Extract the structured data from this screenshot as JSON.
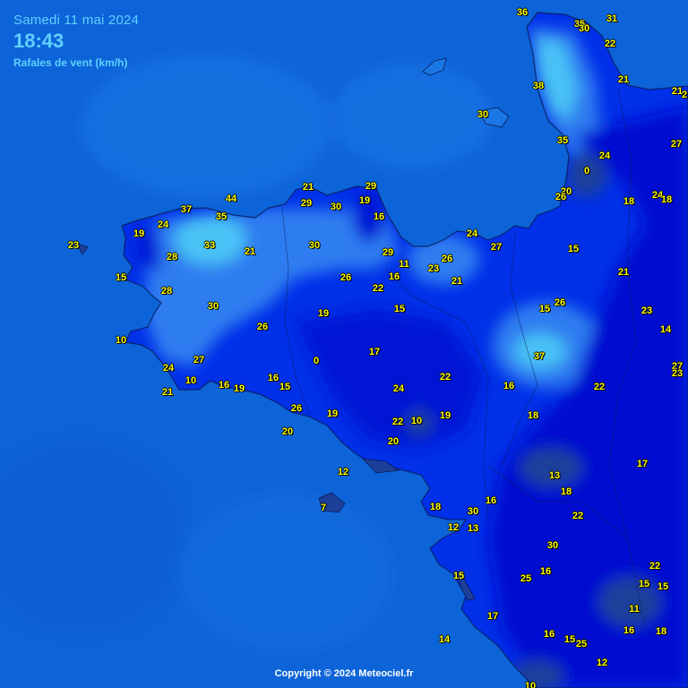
{
  "header": {
    "date": "Samedi 11 mai 2024",
    "time": "18:43",
    "title": "Rafales de vent (km/h)"
  },
  "footer": {
    "copyright": "Copyright © 2024 Meteociel.fr"
  },
  "colors": {
    "sea": "#0d64d8",
    "land_low": "#0010d0",
    "land_mid": "#0030e8",
    "land_high": "#2f7df0",
    "land_peak": "#48c2f5",
    "calm": "#1c3f9a",
    "label": "#ffff00"
  },
  "stations": [
    {
      "value": "36"
    },
    {
      "value": "35"
    },
    {
      "value": "30"
    },
    {
      "value": "31"
    },
    {
      "value": "22"
    },
    {
      "value": "38"
    },
    {
      "value": "21"
    },
    {
      "value": "21"
    },
    {
      "value": "2"
    },
    {
      "value": "30"
    },
    {
      "value": "27"
    },
    {
      "value": "35"
    },
    {
      "value": "24"
    },
    {
      "value": "0"
    },
    {
      "value": "20"
    },
    {
      "value": "26"
    },
    {
      "value": "18"
    },
    {
      "value": "24"
    },
    {
      "value": "18"
    },
    {
      "value": "44"
    },
    {
      "value": "21"
    },
    {
      "value": "29"
    },
    {
      "value": "29"
    },
    {
      "value": "30"
    },
    {
      "value": "19"
    },
    {
      "value": "16"
    },
    {
      "value": "37"
    },
    {
      "value": "35"
    },
    {
      "value": "24"
    },
    {
      "value": "19"
    },
    {
      "value": "23"
    },
    {
      "value": "33"
    },
    {
      "value": "30"
    },
    {
      "value": "21"
    },
    {
      "value": "28"
    },
    {
      "value": "24"
    },
    {
      "value": "27"
    },
    {
      "value": "29"
    },
    {
      "value": "26"
    },
    {
      "value": "11"
    },
    {
      "value": "23"
    },
    {
      "value": "15"
    },
    {
      "value": "16"
    },
    {
      "value": "26"
    },
    {
      "value": "22"
    },
    {
      "value": "21"
    },
    {
      "value": "28"
    },
    {
      "value": "15"
    },
    {
      "value": "21"
    },
    {
      "value": "30"
    },
    {
      "value": "19"
    },
    {
      "value": "15"
    },
    {
      "value": "26"
    },
    {
      "value": "15"
    },
    {
      "value": "23"
    },
    {
      "value": "10"
    },
    {
      "value": "26"
    },
    {
      "value": "14"
    },
    {
      "value": "17"
    },
    {
      "value": "27"
    },
    {
      "value": "0"
    },
    {
      "value": "37"
    },
    {
      "value": "23"
    },
    {
      "value": "24"
    },
    {
      "value": "27"
    },
    {
      "value": "22"
    },
    {
      "value": "10"
    },
    {
      "value": "16"
    },
    {
      "value": "16"
    },
    {
      "value": "19"
    },
    {
      "value": "15"
    },
    {
      "value": "16"
    },
    {
      "value": "24"
    },
    {
      "value": "22"
    },
    {
      "value": "21"
    },
    {
      "value": "26"
    },
    {
      "value": "19"
    },
    {
      "value": "10"
    },
    {
      "value": "19"
    },
    {
      "value": "18"
    },
    {
      "value": "22"
    },
    {
      "value": "20"
    },
    {
      "value": "20"
    },
    {
      "value": "12"
    },
    {
      "value": "13"
    },
    {
      "value": "17"
    },
    {
      "value": "18"
    },
    {
      "value": "16"
    },
    {
      "value": "7"
    },
    {
      "value": "18"
    },
    {
      "value": "30"
    },
    {
      "value": "22"
    },
    {
      "value": "12"
    },
    {
      "value": "13"
    },
    {
      "value": "30"
    },
    {
      "value": "16"
    },
    {
      "value": "22"
    },
    {
      "value": "15"
    },
    {
      "value": "25"
    },
    {
      "value": "15"
    },
    {
      "value": "15"
    },
    {
      "value": "17"
    },
    {
      "value": "11"
    },
    {
      "value": "16"
    },
    {
      "value": "18"
    },
    {
      "value": "16"
    },
    {
      "value": "15"
    },
    {
      "value": "25"
    },
    {
      "value": "14"
    },
    {
      "value": "12"
    },
    {
      "value": "10"
    }
  ]
}
